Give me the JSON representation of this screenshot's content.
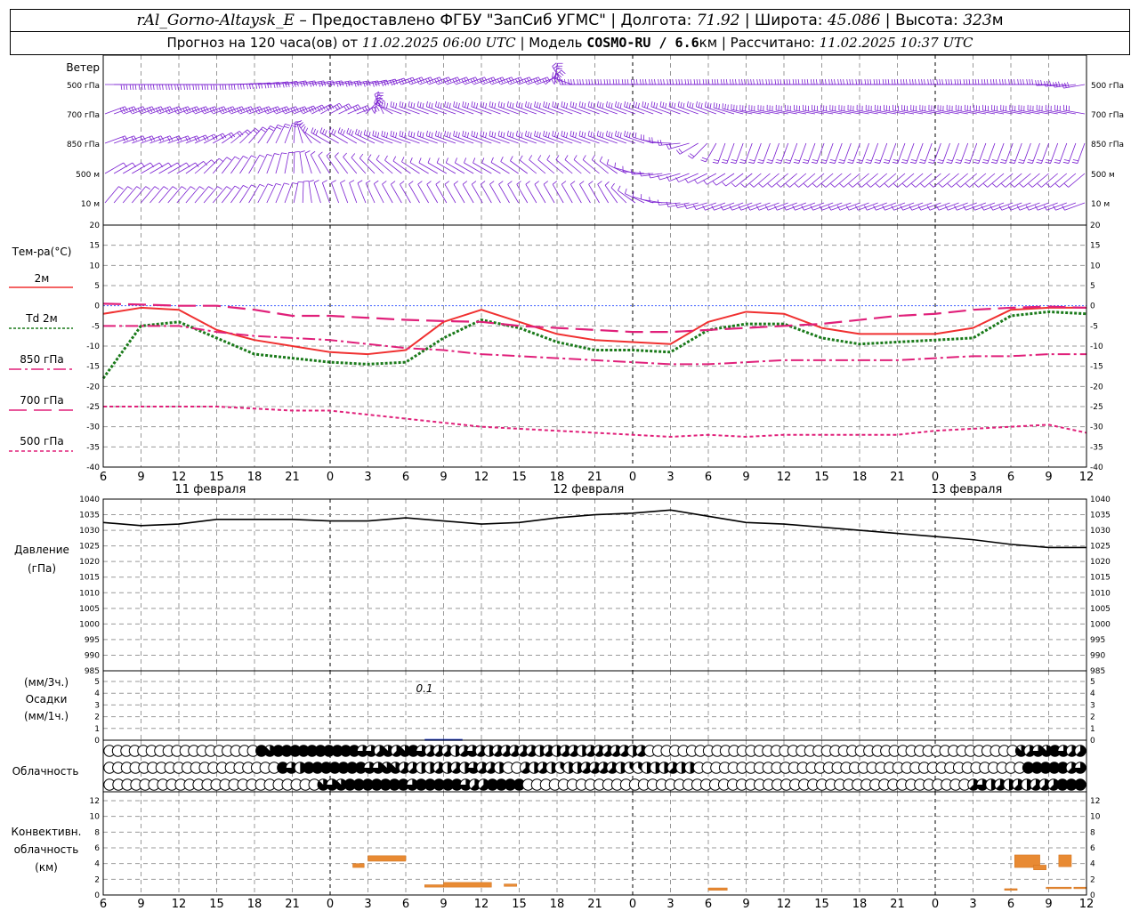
{
  "header": {
    "station": "rAl_Gorno-Altaysk_E",
    "provider": "– Предоставлено ФГБУ \"ЗапСиб УГМС\"",
    "lon_label": "Долгота:",
    "lon_value": "71.92",
    "lat_label": "Широта:",
    "lat_value": "45.086",
    "alt_label": "Высота:",
    "alt_value": "323",
    "alt_unit": "м",
    "forecast_prefix": "Прогноз на 120 часа(ов) от",
    "forecast_start": "11.02.2025 06:00 UTC",
    "model_label": "Модель",
    "model_name": "COSMO-RU / 6.6",
    "model_unit": "км",
    "calc_label": "Рассчитано:",
    "calc_value": "11.02.2025 10:37 UTC"
  },
  "panels": {
    "wind": {
      "title": "Ветер",
      "levels": [
        "500 гПа",
        "700 гПа",
        "850 гПа",
        "500 м",
        "10 м"
      ],
      "color": "#7a1fd1"
    },
    "temperature": {
      "title": "Тем-ра(°C)",
      "legend": [
        {
          "label": "2м",
          "color": "#f03030",
          "dash": "solid"
        },
        {
          "label": "Td  2м",
          "color": "#1a7a1a",
          "dash": "dotted"
        },
        {
          "label": "850 гПа",
          "color": "#e0207a",
          "dash": "dashdot"
        },
        {
          "label": "700 гПа",
          "color": "#e0207a",
          "dash": "longdash"
        },
        {
          "label": "500 гПа",
          "color": "#e0207a",
          "dash": "shortdash"
        }
      ]
    },
    "pressure": {
      "title_line1": "Давление",
      "title_line2": "(гПа)"
    },
    "precip": {
      "title_line1": "(мм/3ч.)",
      "title_line2": "Осадки",
      "title_line3": "(мм/1ч.)",
      "annotation": "0.1"
    },
    "cloud": {
      "title": "Облачность"
    },
    "convective": {
      "title_line1": "Конвективн.",
      "title_line2": "облачность",
      "title_line3": "(км)"
    }
  },
  "x_axis": {
    "hours": [
      "6",
      "9",
      "12",
      "15",
      "18",
      "21",
      "0",
      "3",
      "6",
      "9",
      "12",
      "15",
      "18",
      "21",
      "0",
      "3",
      "6",
      "9",
      "12",
      "15",
      "18",
      "21",
      "0",
      "3",
      "6",
      "9",
      "12"
    ],
    "dates": [
      "11 февраля",
      "12 февраля",
      "13 февраля"
    ]
  },
  "chart_data": [
    {
      "type": "line",
      "title": "Тем-ра(°C)",
      "ylim": [
        -40,
        20
      ],
      "yticks": [
        20,
        15,
        10,
        5,
        0,
        -5,
        -10,
        -15,
        -20,
        -25,
        -30,
        -35,
        -40
      ],
      "x": [
        0,
        3,
        6,
        9,
        12,
        15,
        18,
        21,
        24,
        27,
        30,
        33,
        36,
        39,
        42,
        45,
        48,
        51,
        54,
        57,
        60,
        63,
        66,
        69,
        72,
        75,
        78
      ],
      "series": [
        {
          "name": "2м",
          "values": [
            -2,
            -0.5,
            -1,
            -6,
            -8.5,
            -10,
            -11.5,
            -12,
            -11,
            -4,
            -1,
            -4,
            -7,
            -8.5,
            -9,
            -9.5,
            -4,
            -1.5,
            -2,
            -5.5,
            -7,
            -7,
            -7,
            -5.5,
            -1,
            -0.5,
            -0.5
          ]
        },
        {
          "name": "Td  2м",
          "values": [
            -18,
            -5,
            -4,
            -8,
            -12,
            -13,
            -14,
            -14.5,
            -14,
            -8,
            -3.5,
            -5.5,
            -9,
            -11,
            -11,
            -11.5,
            -6,
            -4.5,
            -4.5,
            -8,
            -9.5,
            -9,
            -8.5,
            -8,
            -2.5,
            -1.5,
            -2
          ]
        },
        {
          "name": "850 гПа",
          "values": [
            -5,
            -5,
            -5,
            -6.5,
            -7.5,
            -8,
            -8.5,
            -9.5,
            -10.5,
            -11,
            -12,
            -12.5,
            -13,
            -13.5,
            -14,
            -14.5,
            -14.5,
            -14,
            -13.5,
            -13.5,
            -13.5,
            -13.5,
            -13,
            -12.5,
            -12.5,
            -12,
            -12
          ]
        },
        {
          "name": "700 гПа",
          "values": [
            0.5,
            0.3,
            0,
            0,
            -1,
            -2.5,
            -2.5,
            -3,
            -3.5,
            -3.8,
            -4,
            -5,
            -5.5,
            -6,
            -6.5,
            -6.5,
            -6,
            -5.5,
            -5,
            -4.5,
            -3.5,
            -2.5,
            -2,
            -1,
            -0.5,
            -0.2,
            -0.5
          ]
        },
        {
          "name": "500 гПа",
          "values": [
            -25,
            -25,
            -25,
            -25,
            -25.5,
            -26,
            -26,
            -27,
            -28,
            -29,
            -30,
            -30.5,
            -31,
            -31.5,
            -32,
            -32.5,
            -32,
            -32.5,
            -32,
            -32,
            -32,
            -32,
            -31,
            -30.5,
            -30,
            -29.5,
            -31.5
          ]
        }
      ]
    },
    {
      "type": "line",
      "title": "Давление (гПа)",
      "ylim": [
        985,
        1040
      ],
      "yticks": [
        1040,
        1035,
        1030,
        1025,
        1020,
        1015,
        1010,
        1005,
        1000,
        995,
        990,
        985
      ],
      "x": [
        0,
        3,
        6,
        9,
        12,
        15,
        18,
        21,
        24,
        27,
        30,
        33,
        36,
        39,
        42,
        45,
        48,
        51,
        54,
        57,
        60,
        63,
        66,
        69,
        72,
        75,
        78
      ],
      "series": [
        {
          "name": "",
          "values": [
            1032.5,
            1031.5,
            1032,
            1033.5,
            1033.5,
            1033.5,
            1033,
            1033,
            1034,
            1033,
            1032,
            1032.5,
            1034,
            1035,
            1035.5,
            1036.5,
            1034.5,
            1032.5,
            1032,
            1031,
            1030,
            1029,
            1028,
            1027,
            1025.5,
            1024.5,
            1024.5
          ]
        }
      ]
    },
    {
      "type": "bar",
      "title": "Осадки (мм/3ч.)",
      "ylim": [
        0,
        5
      ],
      "yticks": [
        5,
        4,
        3,
        2,
        1,
        0
      ],
      "bars": [
        {
          "x": 27,
          "value": 0.1
        }
      ]
    },
    {
      "type": "bar",
      "title": "Конвективн. облачность (км)",
      "ylim": [
        0,
        12
      ],
      "yticks": [
        12,
        10,
        8,
        6,
        4,
        2,
        0
      ],
      "segments": [
        {
          "x0": 19.8,
          "x1": 20.7,
          "bottom": 3.5,
          "top": 4.0
        },
        {
          "x0": 21.0,
          "x1": 24.0,
          "bottom": 4.3,
          "top": 5.0
        },
        {
          "x0": 25.5,
          "x1": 27.0,
          "bottom": 1.0,
          "top": 1.3
        },
        {
          "x0": 27.0,
          "x1": 30.8,
          "bottom": 1.0,
          "top": 1.6
        },
        {
          "x0": 31.8,
          "x1": 32.8,
          "bottom": 1.1,
          "top": 1.4
        },
        {
          "x0": 48.0,
          "x1": 49.5,
          "bottom": 0.6,
          "top": 0.9
        },
        {
          "x0": 71.5,
          "x1": 72.5,
          "bottom": 0.6,
          "top": 0.8
        },
        {
          "x0": 72.3,
          "x1": 74.3,
          "bottom": 3.5,
          "top": 5.1
        },
        {
          "x0": 73.8,
          "x1": 74.8,
          "bottom": 3.2,
          "top": 3.8
        },
        {
          "x0": 75.8,
          "x1": 76.8,
          "bottom": 3.6,
          "top": 5.1
        },
        {
          "x0": 74.8,
          "x1": 76.8,
          "bottom": 0.8,
          "top": 1.0
        },
        {
          "x0": 77.0,
          "x1": 78.0,
          "bottom": 0.8,
          "top": 1.0
        }
      ]
    }
  ],
  "cloud_cover": {
    "rows": [
      "00000000000000000087888888888866575786555456545555545455455555450000000000000000000000000000000000000000000075678655",
      "00000000000000000000864888888866775544545465540054543445555433444544000000000000000000000000000000000000008888856",
      "00000000000000000000000076788888886888886558888000000000000000000000000000000000000000000000000005645454555888"
    ]
  },
  "wind": {
    "rows": [
      {
        "dirs": [
          90,
          90,
          90,
          90,
          85,
          80,
          80,
          80,
          70,
          70,
          70,
          70,
          70,
          270,
          270,
          270,
          270,
          270,
          270,
          270,
          270,
          270,
          270,
          270,
          270,
          270,
          270,
          260
        ],
        "speeds": [
          15,
          15,
          15,
          15,
          15,
          15,
          15,
          15,
          15,
          15,
          15,
          15,
          15,
          15,
          15,
          15,
          15,
          15,
          15,
          15,
          15,
          15,
          15,
          15,
          20,
          20,
          20,
          20
        ]
      },
      {
        "dirs": [
          70,
          70,
          70,
          70,
          70,
          70,
          60,
          70,
          290,
          290,
          290,
          290,
          290,
          290,
          290,
          290,
          290,
          290,
          280,
          280,
          280,
          280,
          280,
          280,
          280,
          280,
          280,
          280
        ],
        "speeds": [
          15,
          15,
          15,
          15,
          15,
          15,
          15,
          15,
          15,
          15,
          15,
          15,
          15,
          15,
          15,
          15,
          15,
          15,
          15,
          15,
          15,
          15,
          15,
          15,
          15,
          15,
          15,
          15
        ]
      },
      {
        "dirs": [
          70,
          70,
          70,
          60,
          40,
          20,
          300,
          300,
          290,
          290,
          290,
          290,
          290,
          290,
          290,
          290,
          260,
          200,
          200,
          200,
          200,
          200,
          200,
          200,
          200,
          200,
          200,
          200
        ],
        "speeds": [
          10,
          10,
          10,
          10,
          10,
          10,
          15,
          15,
          15,
          15,
          15,
          15,
          15,
          15,
          15,
          10,
          10,
          10,
          10,
          10,
          10,
          10,
          10,
          10,
          10,
          10,
          10,
          10
        ]
      },
      {
        "dirs": [
          60,
          60,
          60,
          40,
          30,
          10,
          330,
          320,
          310,
          300,
          300,
          300,
          310,
          310,
          310,
          270,
          250,
          240,
          230,
          230,
          230,
          230,
          230,
          230,
          230,
          230,
          230,
          230
        ],
        "speeds": [
          5,
          5,
          5,
          5,
          5,
          5,
          5,
          5,
          5,
          5,
          5,
          5,
          5,
          5,
          5,
          5,
          5,
          5,
          5,
          5,
          5,
          5,
          5,
          5,
          5,
          5,
          5,
          5
        ]
      },
      {
        "dirs": [
          40,
          40,
          40,
          40,
          30,
          20,
          340,
          340,
          330,
          330,
          330,
          330,
          330,
          330,
          330,
          290,
          260,
          250,
          250,
          250,
          250,
          250,
          250,
          250,
          250,
          250,
          250,
          250
        ],
        "speeds": [
          5,
          5,
          5,
          5,
          5,
          5,
          5,
          5,
          5,
          5,
          5,
          5,
          5,
          5,
          5,
          5,
          5,
          5,
          5,
          5,
          5,
          5,
          5,
          5,
          5,
          5,
          5,
          5
        ]
      }
    ]
  }
}
